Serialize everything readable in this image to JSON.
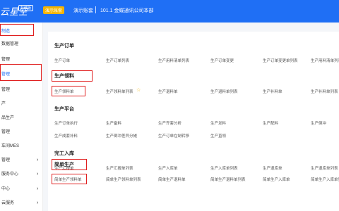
{
  "topbar": {
    "brand": "云星空",
    "brand_badge": "标准版",
    "env_badge": "演示账套",
    "account": "演示账套",
    "org": "101.1 金蝶通讯公司本部"
  },
  "sidebar": {
    "items": [
      {
        "label": "制造",
        "active": true
      },
      {
        "label": "数据管理",
        "active": false
      },
      {
        "label": "管理",
        "active": false
      },
      {
        "label": "管理",
        "active": true
      },
      {
        "label": "管理",
        "active": false
      },
      {
        "label": "产",
        "active": false
      },
      {
        "label": "品生产",
        "active": false
      },
      {
        "label": "管理",
        "active": false
      },
      {
        "label": "车间MES",
        "active": false
      },
      {
        "label": "管理",
        "active": false
      },
      {
        "label": "服务中心",
        "active": false
      },
      {
        "label": "中心",
        "active": false
      },
      {
        "label": "云服务",
        "active": false
      }
    ]
  },
  "sections": {
    "s1": {
      "title": "生产订单",
      "links": [
        "生产订单",
        "生产订单列表",
        "生产用料清单列表",
        "生产订单变更",
        "生产订单变更单列表",
        "生产用料清单列表"
      ]
    },
    "s2": {
      "title": "生产领料",
      "links": [
        "生产领料单",
        "生产领料单列表",
        "生产退料单",
        "生产退料单列表",
        "生产补料单",
        "生产补料单列表"
      ]
    },
    "s3": {
      "title": "生产平台",
      "links": [
        "生产订单执行",
        "生产备料",
        "生产齐套分析",
        "生产发料",
        "生产配料",
        "生产倒冲",
        "生产成套补料",
        "生产倒冲差异分摊",
        "生产订单在制转移",
        "生产直领"
      ]
    },
    "s4": {
      "title": "完工入库",
      "links": [
        "生产汇报单",
        "生产汇报单列表",
        "生产入库单",
        "生产入库单列表",
        "生产退库单",
        "生产退库单列表"
      ]
    },
    "s5": {
      "title": "简单生产",
      "links": [
        "简单生产领料单",
        "简单生产领料单列表",
        "简单生产退料单",
        "简单生产退料单列表",
        "简单生产入库单",
        "简单生产入库单列表"
      ]
    }
  }
}
